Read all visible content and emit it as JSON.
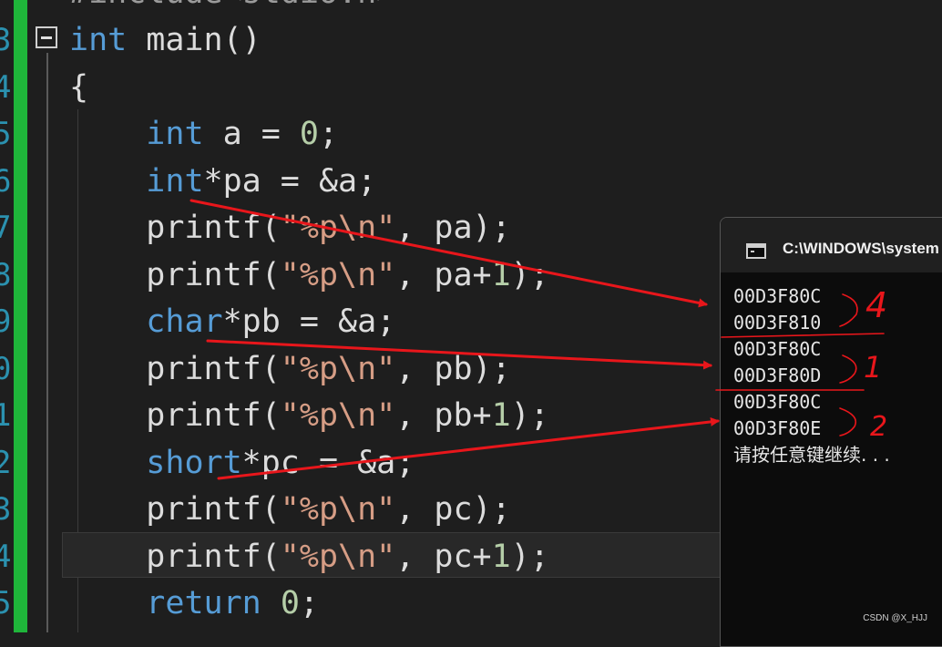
{
  "editor": {
    "gutter": {
      "line_numbers": [
        "3",
        "4",
        "5",
        "6",
        "7",
        "8",
        "9",
        "0",
        "1",
        "2",
        "3",
        "4",
        "5"
      ]
    },
    "top_partial_line": "#include<stdio.h>",
    "lines": [
      {
        "tokens": [
          {
            "t": "int",
            "c": "kw"
          },
          {
            "t": " main()",
            "c": "plain"
          }
        ]
      },
      {
        "tokens": [
          {
            "t": "{",
            "c": "plain"
          }
        ]
      },
      {
        "tokens": [
          {
            "t": "    ",
            "c": "plain"
          },
          {
            "t": "int",
            "c": "kw"
          },
          {
            "t": " a = ",
            "c": "plain"
          },
          {
            "t": "0",
            "c": "num"
          },
          {
            "t": ";",
            "c": "plain"
          }
        ]
      },
      {
        "tokens": [
          {
            "t": "    ",
            "c": "plain"
          },
          {
            "t": "int",
            "c": "kw"
          },
          {
            "t": "*pa = &a;",
            "c": "plain"
          }
        ]
      },
      {
        "tokens": [
          {
            "t": "    printf(",
            "c": "plain"
          },
          {
            "t": "\"%p\\n\"",
            "c": "str"
          },
          {
            "t": ", pa);",
            "c": "plain"
          }
        ]
      },
      {
        "tokens": [
          {
            "t": "    printf(",
            "c": "plain"
          },
          {
            "t": "\"%p\\n\"",
            "c": "str"
          },
          {
            "t": ", pa+",
            "c": "plain"
          },
          {
            "t": "1",
            "c": "num"
          },
          {
            "t": ");",
            "c": "plain"
          }
        ]
      },
      {
        "tokens": [
          {
            "t": "    ",
            "c": "plain"
          },
          {
            "t": "char",
            "c": "kw"
          },
          {
            "t": "*pb = &a;",
            "c": "plain"
          }
        ]
      },
      {
        "tokens": [
          {
            "t": "    printf(",
            "c": "plain"
          },
          {
            "t": "\"%p\\n\"",
            "c": "str"
          },
          {
            "t": ", pb);",
            "c": "plain"
          }
        ]
      },
      {
        "tokens": [
          {
            "t": "    printf(",
            "c": "plain"
          },
          {
            "t": "\"%p\\n\"",
            "c": "str"
          },
          {
            "t": ", pb+",
            "c": "plain"
          },
          {
            "t": "1",
            "c": "num"
          },
          {
            "t": ");",
            "c": "plain"
          }
        ]
      },
      {
        "tokens": [
          {
            "t": "    ",
            "c": "plain"
          },
          {
            "t": "short",
            "c": "kw"
          },
          {
            "t": "*pc = &a;",
            "c": "plain"
          }
        ]
      },
      {
        "tokens": [
          {
            "t": "    printf(",
            "c": "plain"
          },
          {
            "t": "\"%p\\n\"",
            "c": "str"
          },
          {
            "t": ", pc);",
            "c": "plain"
          }
        ]
      },
      {
        "tokens": [
          {
            "t": "    printf(",
            "c": "plain"
          },
          {
            "t": "\"%p\\n\"",
            "c": "str"
          },
          {
            "t": ", pc+",
            "c": "plain"
          },
          {
            "t": "1",
            "c": "num"
          },
          {
            "t": ");",
            "c": "plain"
          }
        ]
      },
      {
        "tokens": [
          {
            "t": "    ",
            "c": "plain"
          },
          {
            "t": "return",
            "c": "kw"
          },
          {
            "t": " ",
            "c": "plain"
          },
          {
            "t": "0",
            "c": "num"
          },
          {
            "t": ";",
            "c": "plain"
          }
        ]
      }
    ],
    "colors": {
      "background": "#1e1e1e",
      "keyword": "#569cd6",
      "string": "#d69d85",
      "number": "#b5cea8",
      "line_number": "#2b91af",
      "change_bar": "#1fb53a"
    }
  },
  "console": {
    "title": "C:\\WINDOWS\\system",
    "output_lines": [
      "00D3F80C",
      "00D3F810",
      "00D3F80C",
      "00D3F80D",
      "00D3F80C",
      "00D3F80E"
    ],
    "prompt": "请按任意键继续. . .",
    "background": "#0c0c0c"
  },
  "annotations": {
    "color": "#e8161b",
    "handwritten_numbers": [
      "4",
      "1",
      "2"
    ]
  },
  "watermark": "CSDN @X_HJJ"
}
